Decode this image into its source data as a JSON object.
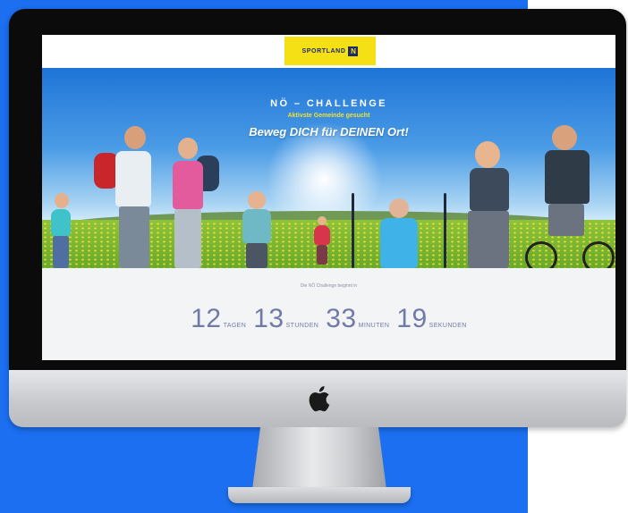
{
  "site": {
    "logo_text": "SPORTLAND",
    "logo_mark": "N"
  },
  "hero": {
    "title": "NÖ – CHALLENGE",
    "subtitle": "Aktivste Gemeinde gesucht",
    "slogan": "Beweg DICH für DEINEN Ort!"
  },
  "countdown": {
    "label": "Die NÖ Challenge beginnt in",
    "days_value": "12",
    "days_unit": "TAGEN",
    "hours_value": "13",
    "hours_unit": "STUNDEN",
    "minutes_value": "33",
    "minutes_unit": "MINUTEN",
    "seconds_value": "19",
    "seconds_unit": "SEKUNDEN"
  },
  "colors": {
    "page_background": "#1b6ff0",
    "logo_background": "#f5df15",
    "subtitle_color": "#f2e22a",
    "countdown_color": "#6f7aa6"
  }
}
